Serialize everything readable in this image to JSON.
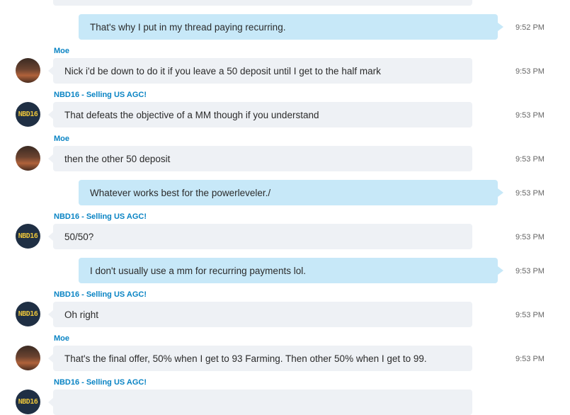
{
  "messages": [
    {
      "kind": "out",
      "text": "That's why I put in my thread paying recurring.",
      "time": "9:52 PM"
    },
    {
      "kind": "in",
      "sender": "Moe",
      "avatar": "moe",
      "text": "Nick i'd be down to do it if you leave a 50 deposit until I get to the half mark",
      "time": "9:53 PM"
    },
    {
      "kind": "in",
      "sender": "NBD16 - Selling US AGC!",
      "avatar": "nbd16",
      "text": "That defeats the objective of a MM though if you understand",
      "time": "9:53 PM"
    },
    {
      "kind": "in",
      "sender": "Moe",
      "avatar": "moe",
      "text": "then the other 50 deposit",
      "time": "9:53 PM"
    },
    {
      "kind": "out",
      "text": "Whatever works best for the powerleveler./",
      "time": "9:53 PM"
    },
    {
      "kind": "in",
      "sender": "NBD16 - Selling US AGC!",
      "avatar": "nbd16",
      "text": "50/50?",
      "time": "9:53 PM"
    },
    {
      "kind": "out",
      "text": "I don't usually use a mm for recurring payments lol.",
      "time": "9:53 PM"
    },
    {
      "kind": "in",
      "sender": "NBD16 - Selling US AGC!",
      "avatar": "nbd16",
      "text": "Oh right",
      "time": "9:53 PM"
    },
    {
      "kind": "in",
      "sender": "Moe",
      "avatar": "moe",
      "text": "That's the final offer, 50% when I get to 93 Farming. Then other 50% when I get to 99.",
      "time": "9:53 PM"
    },
    {
      "kind": "in",
      "sender": "NBD16 - Selling US AGC!",
      "avatar": "nbd16",
      "text": "",
      "time": ""
    }
  ],
  "avatar_labels": {
    "nbd16": "NBD16"
  }
}
